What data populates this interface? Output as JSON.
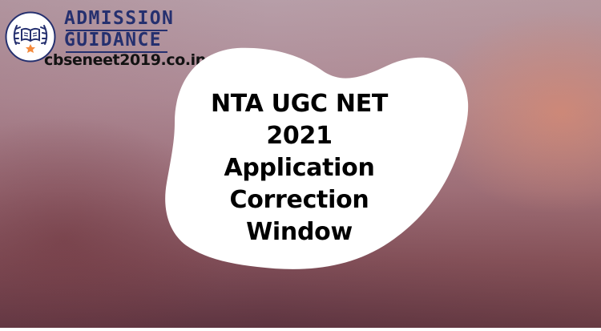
{
  "logo": {
    "brand_line1": "ADMISSION",
    "brand_line2": "GUIDANCE",
    "website": "cbseneet2019.co.in",
    "badge_icon": "book-laurel-icon",
    "star_icon": "star-icon"
  },
  "headline": {
    "lines": [
      "NTA UGC NET",
      "2021",
      "Application",
      "Correction",
      "Window"
    ]
  },
  "colors": {
    "background_top": "#b79ea8",
    "background_mid": "#9c6e79",
    "background_bottom": "#5d3440",
    "blob": "#ffffff",
    "headline_text": "#000000",
    "brand_text": "#25306f",
    "website_text": "#121212",
    "accent_star": "#f48a3c"
  }
}
